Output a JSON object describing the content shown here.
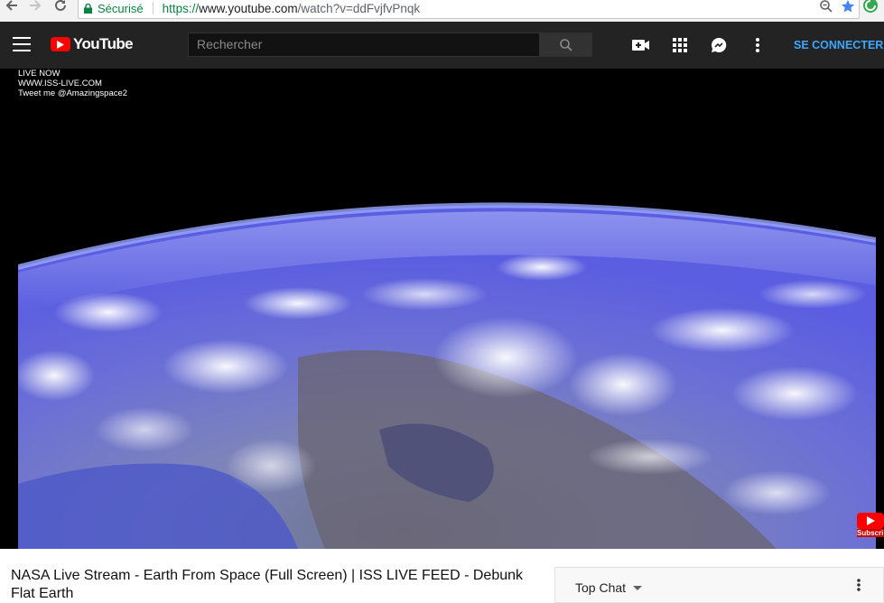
{
  "browser": {
    "secure_label": "Sécurisé",
    "url_scheme": "https://",
    "url_host": "www.youtube.com",
    "url_path": "/watch?v=ddFvjfvPnqk"
  },
  "header": {
    "logo_text": "YouTube",
    "search_placeholder": "Rechercher",
    "signin_label": "SE CONNECTER",
    "brand_color": "#ff0000",
    "signin_color": "#3ea6ff"
  },
  "video": {
    "overlay": {
      "line1": "LIVE NOW",
      "line2": "WWW.ISS-LIVE.COM",
      "line3": "Tweet me @Amazingspace2"
    },
    "subscribe_badge": "Subscri"
  },
  "below": {
    "title": "NASA Live Stream - Earth From Space (Full Screen) | ISS LIVE FEED - Debunk Flat Earth",
    "chat_label": "Top Chat"
  },
  "icons": [
    "back-icon",
    "forward-icon",
    "reload-icon",
    "lock-icon",
    "zoom-icon",
    "star-icon",
    "extension-icon",
    "menu-icon",
    "search-icon",
    "upload-icon",
    "apps-icon",
    "messages-icon",
    "more-icon",
    "caret-down-icon"
  ]
}
